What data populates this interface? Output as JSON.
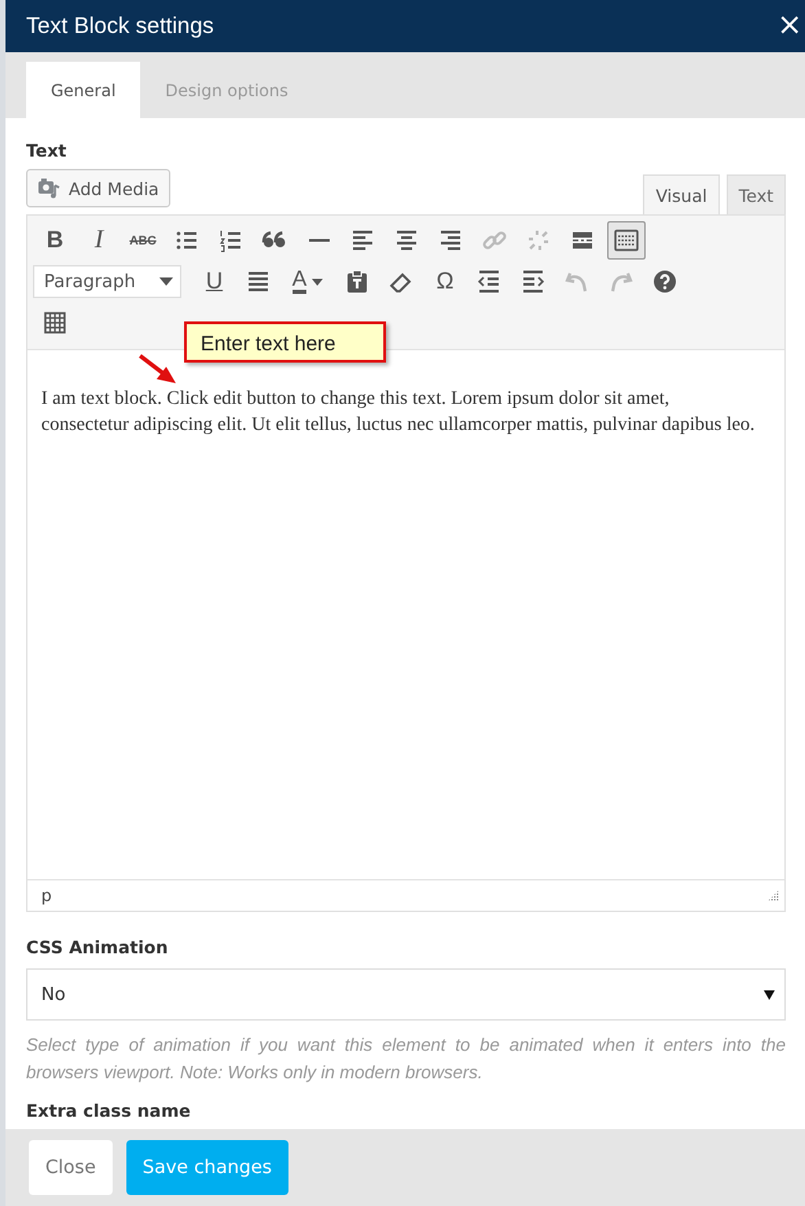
{
  "window": {
    "title": "Text Block settings",
    "close": "×"
  },
  "tabs": [
    {
      "label": "General",
      "selected": true
    },
    {
      "label": "Design options",
      "selected": false
    }
  ],
  "text_field": {
    "label": "Text",
    "add_media": "Add Media",
    "editor_tabs": [
      {
        "label": "Visual",
        "selected": true
      },
      {
        "label": "Text",
        "selected": false
      }
    ],
    "toolbar": [
      [
        {
          "kind": "bold",
          "label": "B",
          "disabled": false,
          "pressed": false
        },
        {
          "kind": "italic",
          "label": "I",
          "disabled": false,
          "pressed": false
        },
        {
          "kind": "strike",
          "label": "ABC",
          "disabled": false,
          "pressed": false
        },
        {
          "kind": "bullets",
          "disabled": false,
          "pressed": false
        },
        {
          "kind": "numbers",
          "disabled": false,
          "pressed": false
        },
        {
          "kind": "quote",
          "disabled": false,
          "pressed": false
        },
        {
          "kind": "rule",
          "disabled": false,
          "pressed": false
        },
        {
          "kind": "align-left",
          "disabled": false,
          "pressed": false
        },
        {
          "kind": "align-center",
          "disabled": false,
          "pressed": false
        },
        {
          "kind": "align-right",
          "disabled": false,
          "pressed": false
        },
        {
          "kind": "link",
          "disabled": true,
          "pressed": false
        },
        {
          "kind": "unlink",
          "disabled": true,
          "pressed": false
        },
        {
          "kind": "more",
          "disabled": false,
          "pressed": false
        },
        {
          "kind": "toolbar",
          "disabled": false,
          "pressed": true
        }
      ],
      [
        {
          "kind": "select",
          "label": "Paragraph"
        },
        {
          "kind": "underline",
          "label": "U",
          "disabled": false,
          "pressed": false
        },
        {
          "kind": "justify",
          "disabled": false,
          "pressed": false
        },
        {
          "kind": "color",
          "label": "A",
          "disabled": false,
          "pressed": false
        },
        {
          "kind": "paste",
          "disabled": false,
          "pressed": false
        },
        {
          "kind": "eraser",
          "disabled": false,
          "pressed": false
        },
        {
          "kind": "symbol",
          "label": "Ω",
          "disabled": false,
          "pressed": false
        },
        {
          "kind": "outdent",
          "disabled": false,
          "pressed": false
        },
        {
          "kind": "indent",
          "disabled": false,
          "pressed": false
        },
        {
          "kind": "undo",
          "disabled": true,
          "pressed": false
        },
        {
          "kind": "redo",
          "disabled": true,
          "pressed": false
        },
        {
          "kind": "help",
          "disabled": false,
          "pressed": false
        }
      ],
      [
        {
          "kind": "table",
          "disabled": false,
          "pressed": false
        }
      ]
    ],
    "content": "I am text block. Click edit button to change this text. Lorem ipsum dolor sit amet, consectetur adipiscing elit. Ut elit tellus, luctus nec ullamcorper mattis, pulvinar dapibus leo.",
    "path": "p",
    "annotation": "Enter text here"
  },
  "css_animation": {
    "label": "CSS Animation",
    "value": "No",
    "help": "Select type of animation if you want this element to be animated when it enters into the browsers viewport. Note: Works only in modern browsers."
  },
  "extra_class": {
    "label": "Extra class name"
  },
  "buttons": [
    {
      "label": "Close",
      "kind": "secondary"
    },
    {
      "label": "Save changes",
      "kind": "primary"
    }
  ]
}
